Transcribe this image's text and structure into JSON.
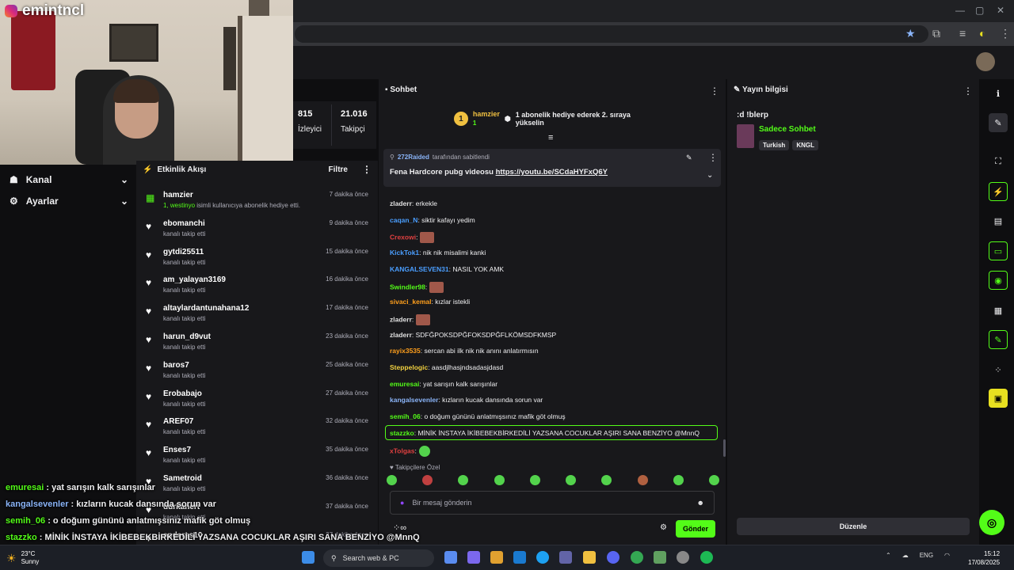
{
  "stream": {
    "channel_name": "emintncl"
  },
  "left_nav": {
    "items": [
      {
        "label": "Kanal"
      },
      {
        "label": "Ayarlar"
      }
    ]
  },
  "stats": {
    "viewers": "815",
    "viewers_label": "İzleyici",
    "followers": "21.016",
    "followers_label": "Takipçi"
  },
  "activity": {
    "title": "Etkinlik Akışı",
    "filter_label": "Filtre",
    "events": [
      {
        "user": "hamzier",
        "desc_highlight": "1, westinyo",
        "desc": " isimli kullanıcıya abonelik hediye etti.",
        "time": "7 dakika önce",
        "icon": "gift-icon"
      },
      {
        "user": "ebomanchi",
        "desc": "kanalı takip etti",
        "time": "9 dakika önce",
        "icon": "heart-icon"
      },
      {
        "user": "gytdi25511",
        "desc": "kanalı takip etti",
        "time": "15 dakika önce",
        "icon": "heart-icon"
      },
      {
        "user": "am_yalayan3169",
        "desc": "kanalı takip etti",
        "time": "16 dakika önce",
        "icon": "heart-icon"
      },
      {
        "user": "altaylardantunahana12",
        "desc": "kanalı takip etti",
        "time": "17 dakika önce",
        "icon": "heart-icon"
      },
      {
        "user": "harun_d9vut",
        "desc": "kanalı takip etti",
        "time": "23 dakika önce",
        "icon": "heart-icon"
      },
      {
        "user": "baros7",
        "desc": "kanalı takip etti",
        "time": "25 dakika önce",
        "icon": "heart-icon"
      },
      {
        "user": "Erobabajo",
        "desc": "kanalı takip etti",
        "time": "27 dakika önce",
        "icon": "heart-icon"
      },
      {
        "user": "AREF07",
        "desc": "kanalı takip etti",
        "time": "32 dakika önce",
        "icon": "heart-icon"
      },
      {
        "user": "Enses7",
        "desc": "kanalı takip etti",
        "time": "35 dakika önce",
        "icon": "heart-icon"
      },
      {
        "user": "Sametroid",
        "desc": "kanalı takip etti",
        "time": "36 dakika önce",
        "icon": "heart-icon"
      },
      {
        "user": "durkanert",
        "desc": "kanalı takip etti",
        "time": "37 dakika önce",
        "icon": "heart-icon"
      },
      {
        "user": "enderss10",
        "desc": "",
        "time": "37 dakika önce",
        "icon": "heart-icon"
      }
    ]
  },
  "chat": {
    "title": "Sohbet",
    "gift_banner": {
      "user": "hamzier",
      "count": "1",
      "level": "1",
      "text": "1 abonelik hediye ederek 2. sıraya yükselin"
    },
    "pinned": {
      "user": "272Raided",
      "by_text": "tarafından sabitlendi",
      "text": "Fena Hardcore pubg videosu",
      "link": "https://youtu.be/SCdaHYFxQ6Y"
    },
    "messages": [
      {
        "user": "zladerr",
        "color": "#e0e0e0",
        "text": ": erkekle",
        "emote": false
      },
      {
        "user": "caqan_N",
        "color": "#4a9eff",
        "text": ": siktir kafayı yedim",
        "emote": false
      },
      {
        "user": "Crexowi",
        "color": "#e04040",
        "text": ":",
        "emote": true
      },
      {
        "user": "KickTok1",
        "color": "#4a9eff",
        "text": ": nik nik misalimi kanki",
        "emote": false
      },
      {
        "user": "KANGALSEVEN31",
        "color": "#4a9eff",
        "text": ": NASIL YOK AMK",
        "emote": false
      },
      {
        "user": "Swindler98",
        "color": "#53fc18",
        "text": ":",
        "emote": true
      },
      {
        "user": "sivaci_kemal",
        "color": "#ff9f1c",
        "text": ": kızlar istekli",
        "emote": false
      },
      {
        "user": "zladerr",
        "color": "#e0e0e0",
        "text": ":",
        "emote": true
      },
      {
        "user": "zladerr",
        "color": "#e0e0e0",
        "text": ": SDFĞPOKSDPĞFOKSDPĞFLKÖMSDFKMSP",
        "emote": false
      },
      {
        "user": "rayix3535",
        "color": "#ff9f1c",
        "text": ": sercan abi ilk nik nik anını anlatırmısın",
        "emote": false
      },
      {
        "user": "Steppelogic",
        "color": "#f0d040",
        "text": ": aasdjlhasjndsadasjdasd",
        "emote": false
      },
      {
        "user": "emuresai",
        "color": "#53fc18",
        "text": ": yat sarışın kalk sarışınlar",
        "emote": false
      },
      {
        "user": "kangalsevenler",
        "color": "#8ab4f8",
        "text": ": kızların kucak dansında sorun var",
        "emote": false
      },
      {
        "user": "semih_06",
        "color": "#53fc18",
        "text": ": o doğum gününü anlatmışsınız mafik göt olmuş",
        "emote": false
      },
      {
        "user": "stazzko",
        "color": "#53fc18",
        "text": ": MİNİK İNSTAYA İKİBEBEKBİRKEDİLİ YAZSANA COCUKLAR AŞIRI SANA BENZİYO @MnnQ",
        "emote": false
      },
      {
        "user": "xTolgas",
        "color": "#e04040",
        "text": ":",
        "emote": true
      }
    ],
    "emote_section_label": "Takipçilere Özel",
    "input_placeholder": "Bir mesaj gönderin",
    "send_label": "Gönder"
  },
  "stream_info": {
    "title": "Yayın bilgisi",
    "stream_title": ":d !blerp",
    "category": "Sadece Sohbet",
    "tags": [
      "Turkish",
      "KNGL"
    ],
    "edit_label": "Düzenle"
  },
  "overlay_chat": [
    {
      "user": "emuresai",
      "color": "#53fc18",
      "text": " : yat sarışın kalk sarışınlar"
    },
    {
      "user": "kangalsevenler",
      "color": "#8ab4f8",
      "text": " : kızların kucak dansında sorun var"
    },
    {
      "user": "semih_06",
      "color": "#53fc18",
      "text": " : o doğum gününü anlatmışsınız mafik göt olmuş"
    },
    {
      "user": "stazzko",
      "color": "#53fc18",
      "text": " : MİNİK İNSTAYA İKİBEBEKBİRKEDİLİ YAZSANA COCUKLAR AŞIRI SANA BENZİYO @MnnQ"
    }
  ],
  "taskbar": {
    "weather_temp": "23°C",
    "weather_desc": "Sunny",
    "search_placeholder": "Search web & PC",
    "lang": "ENG",
    "time": "15:12",
    "date": "17/08/2025"
  },
  "colors": {
    "accent": "#53fc18",
    "bg": "#0e0e10",
    "panel": "#18181b"
  }
}
